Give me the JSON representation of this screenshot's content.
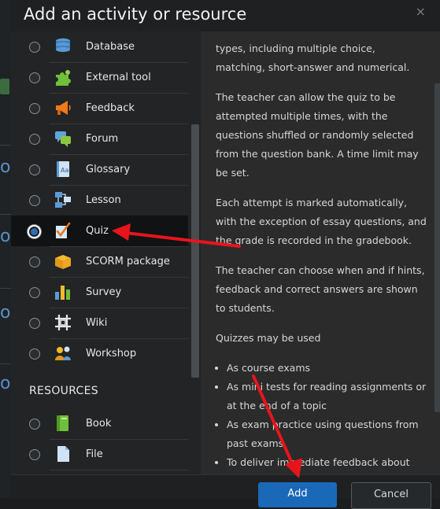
{
  "dialog": {
    "title": "Add an activity or resource",
    "close_glyph": "×"
  },
  "activities": [
    {
      "label": "Database",
      "icon": "database-icon",
      "selected": false
    },
    {
      "label": "External tool",
      "icon": "external-tool-icon",
      "selected": false
    },
    {
      "label": "Feedback",
      "icon": "feedback-icon",
      "selected": false
    },
    {
      "label": "Forum",
      "icon": "forum-icon",
      "selected": false
    },
    {
      "label": "Glossary",
      "icon": "glossary-icon",
      "selected": false
    },
    {
      "label": "Lesson",
      "icon": "lesson-icon",
      "selected": false
    },
    {
      "label": "Quiz",
      "icon": "quiz-icon",
      "selected": true
    },
    {
      "label": "SCORM package",
      "icon": "scorm-package-icon",
      "selected": false
    },
    {
      "label": "Survey",
      "icon": "survey-icon",
      "selected": false
    },
    {
      "label": "Wiki",
      "icon": "wiki-icon",
      "selected": false
    },
    {
      "label": "Workshop",
      "icon": "workshop-icon",
      "selected": false
    }
  ],
  "resources_heading": "RESOURCES",
  "resources": [
    {
      "label": "Book",
      "icon": "book-icon",
      "selected": false
    },
    {
      "label": "File",
      "icon": "file-icon",
      "selected": false
    }
  ],
  "help": {
    "paragraphs": [
      "types, including multiple choice, matching, short-answer and numerical.",
      "The teacher can allow the quiz to be attempted multiple times, with the questions shuffled or randomly selected from the question bank. A time limit may be set.",
      "Each attempt is marked automatically, with the exception of essay questions, and the grade is recorded in the gradebook.",
      "The teacher can choose when and if hints, feedback and correct answers are shown to students.",
      "Quizzes may be used"
    ],
    "list": [
      "As course exams",
      "As mini tests for reading assignments or at the end of a topic",
      "As exam practice using questions from past exams",
      "To deliver immediate feedback about"
    ]
  },
  "footer": {
    "add_label": "Add",
    "cancel_label": "Cancel"
  },
  "background": {
    "fragments": [
      "op",
      "op",
      "op",
      "op"
    ]
  },
  "colors": {
    "primary_button": "#1a68b8",
    "annotation_arrow": "#e8141c",
    "selected_radio": "#2f6fb8"
  }
}
